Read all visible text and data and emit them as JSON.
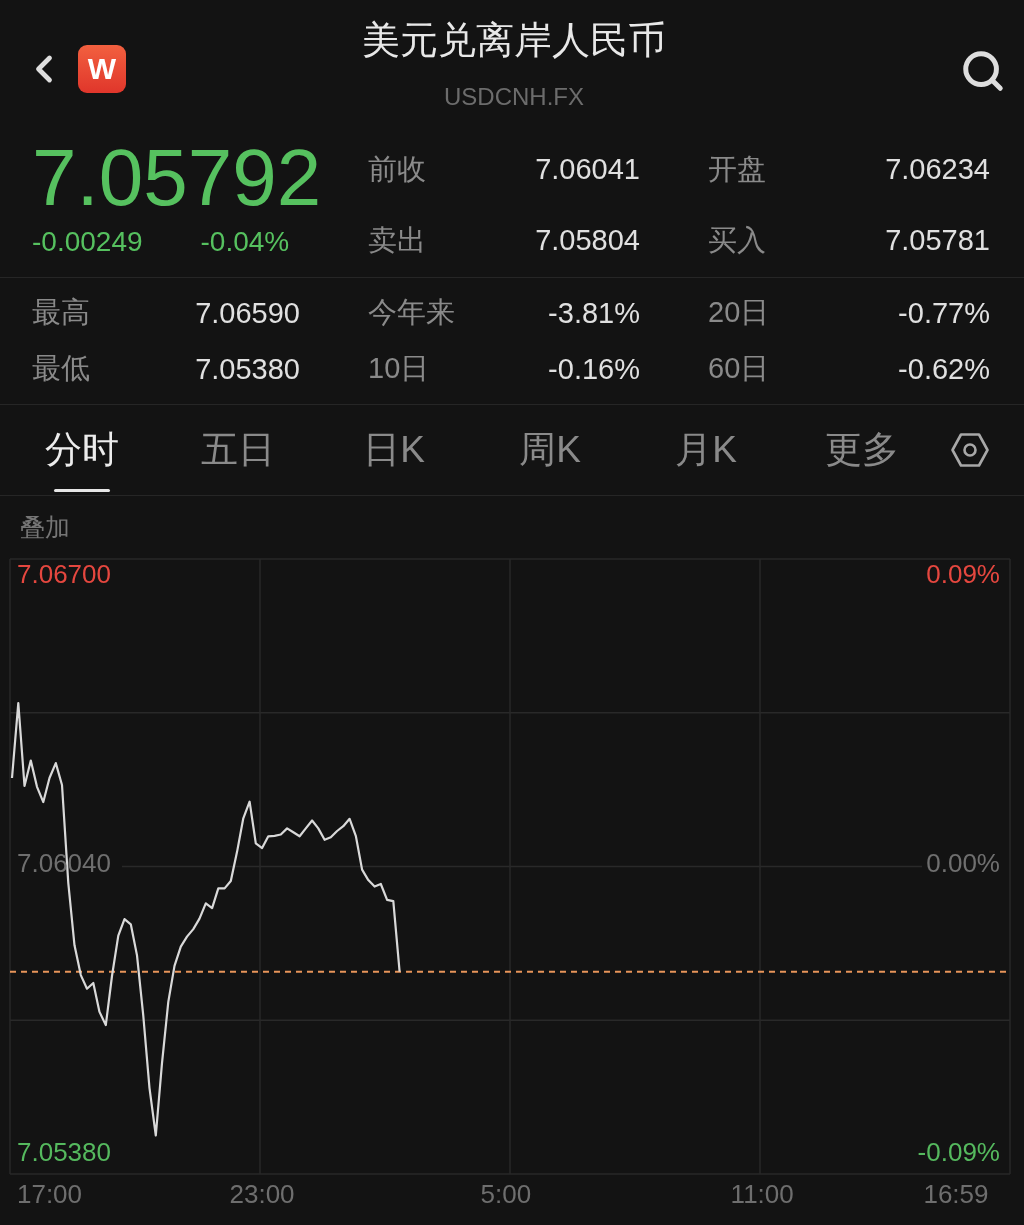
{
  "header": {
    "logo_letter": "W",
    "title": "美元兑离岸人民币",
    "symbol": "USDCNH.FX"
  },
  "quote": {
    "price": "7.05792",
    "change": "-0.00249",
    "change_percent": "-0.04%",
    "falling": true,
    "fields": [
      {
        "label": "前收",
        "value": "7.06041"
      },
      {
        "label": "开盘",
        "value": "7.06234"
      },
      {
        "label": "卖出",
        "value": "7.05804"
      },
      {
        "label": "买入",
        "value": "7.05781"
      }
    ]
  },
  "stats": [
    {
      "label": "最高",
      "value": "7.06590"
    },
    {
      "label": "今年来",
      "value": "-3.81%"
    },
    {
      "label": "20日",
      "value": "-0.77%"
    },
    {
      "label": "最低",
      "value": "7.05380"
    },
    {
      "label": "10日",
      "value": "-0.16%"
    },
    {
      "label": "60日",
      "value": "-0.62%"
    }
  ],
  "tabs": [
    {
      "label": "分时",
      "selected": true
    },
    {
      "label": "五日",
      "selected": false
    },
    {
      "label": "日K",
      "selected": false
    },
    {
      "label": "周K",
      "selected": false
    },
    {
      "label": "月K",
      "selected": false
    },
    {
      "label": "更多",
      "selected": false
    }
  ],
  "overlay_button": "叠加",
  "chart": {
    "right_labels": [
      "0.09%",
      "0.00%",
      "-0.09%"
    ],
    "chart_data": {
      "type": "line",
      "categories": [
        null,
        null,
        null,
        null,
        null,
        null,
        "17:00",
        null,
        null,
        null,
        null,
        null,
        null,
        null,
        null,
        null,
        null,
        null,
        null,
        null,
        null,
        null,
        null,
        null,
        null,
        null,
        null,
        null,
        null,
        null,
        null,
        null,
        null,
        null,
        null,
        null,
        null,
        null,
        null,
        null,
        "23:00",
        null,
        null,
        null,
        null,
        null,
        null,
        null,
        null,
        null,
        null,
        null,
        null,
        null,
        null,
        null,
        null,
        null,
        null,
        null,
        null,
        null,
        null,
        null,
        null,
        null,
        null,
        null,
        null,
        null,
        null,
        null,
        null,
        null,
        null,
        null,
        null,
        null,
        null,
        "5:00",
        null,
        null,
        null,
        null,
        null,
        null,
        null,
        null,
        null,
        null,
        null,
        null,
        null,
        null,
        null,
        null,
        null,
        null,
        null,
        null,
        null,
        null,
        null,
        null,
        null,
        null,
        null,
        null,
        null,
        null,
        null,
        null,
        null,
        null,
        null,
        null,
        null,
        null,
        null,
        null,
        "11:00",
        null,
        null,
        null,
        null,
        null,
        null,
        null,
        null,
        null,
        null,
        null,
        null,
        null,
        null,
        null,
        null,
        null,
        null,
        null,
        null,
        null,
        null,
        null,
        null,
        null,
        null,
        null,
        null,
        null,
        null,
        "16:59",
        null,
        null,
        null,
        null,
        null,
        null,
        null,
        null
      ],
      "series": [
        {
          "color": "#d9d9d9",
          "values": [
            7.06234,
            7.06405,
            7.06216,
            7.06274,
            7.06214,
            7.06179,
            7.06234,
            7.06268,
            7.06218,
            7.05994,
            7.05852,
            7.05784,
            7.05753,
            7.05766,
            7.057,
            7.0567,
            7.05782,
            7.05874,
            7.05912,
            7.059,
            7.05829,
            7.05691,
            7.05526,
            7.05418,
            7.05583,
            7.05723,
            7.05805,
            7.05849,
            7.05872,
            7.05889,
            7.05913,
            7.05948,
            7.05937,
            7.05982,
            7.05982,
            7.05999,
            7.06066,
            7.06142,
            7.0618,
            7.06085,
            7.06074,
            7.06101,
            7.06102,
            7.06105,
            7.06119,
            7.0611,
            7.06101,
            7.06119,
            7.06137,
            7.06119,
            7.06093,
            7.06099,
            7.06113,
            7.06124,
            7.06141,
            7.06102,
            7.06025,
            7.06001,
            7.05986,
            7.05992,
            7.05956,
            7.05953,
            7.05792,
            null,
            null,
            null,
            null,
            null,
            null,
            null,
            null,
            null,
            null,
            null,
            null,
            null,
            null,
            null,
            null,
            null,
            null,
            null,
            null,
            null,
            null,
            null,
            null,
            null,
            null,
            null,
            null,
            null,
            null,
            null,
            null,
            null,
            null,
            null,
            null,
            null,
            null,
            null,
            null,
            null,
            null,
            null,
            null,
            null,
            null,
            null,
            null,
            null,
            null,
            null,
            null,
            null,
            null,
            null,
            null,
            null,
            null,
            null,
            null,
            null,
            null,
            null,
            null,
            null,
            null,
            null,
            null,
            null,
            null,
            null,
            null,
            null,
            null,
            null,
            null,
            null,
            null,
            null,
            null,
            null,
            null,
            null,
            null,
            null,
            null,
            null,
            null,
            null,
            null,
            null,
            null,
            null,
            null,
            null,
            null,
            null
          ]
        }
      ],
      "ylim": [
        7.0533,
        7.06734
      ],
      "yticks": [
        {
          "value": 7.067,
          "label": "7.06700"
        },
        {
          "value": 7.0604,
          "label": "7.06040"
        },
        {
          "value": 7.0538,
          "label": "7.05380"
        }
      ],
      "ref_lines": [
        {
          "axis": "y",
          "value": 7.05792
        }
      ]
    }
  }
}
